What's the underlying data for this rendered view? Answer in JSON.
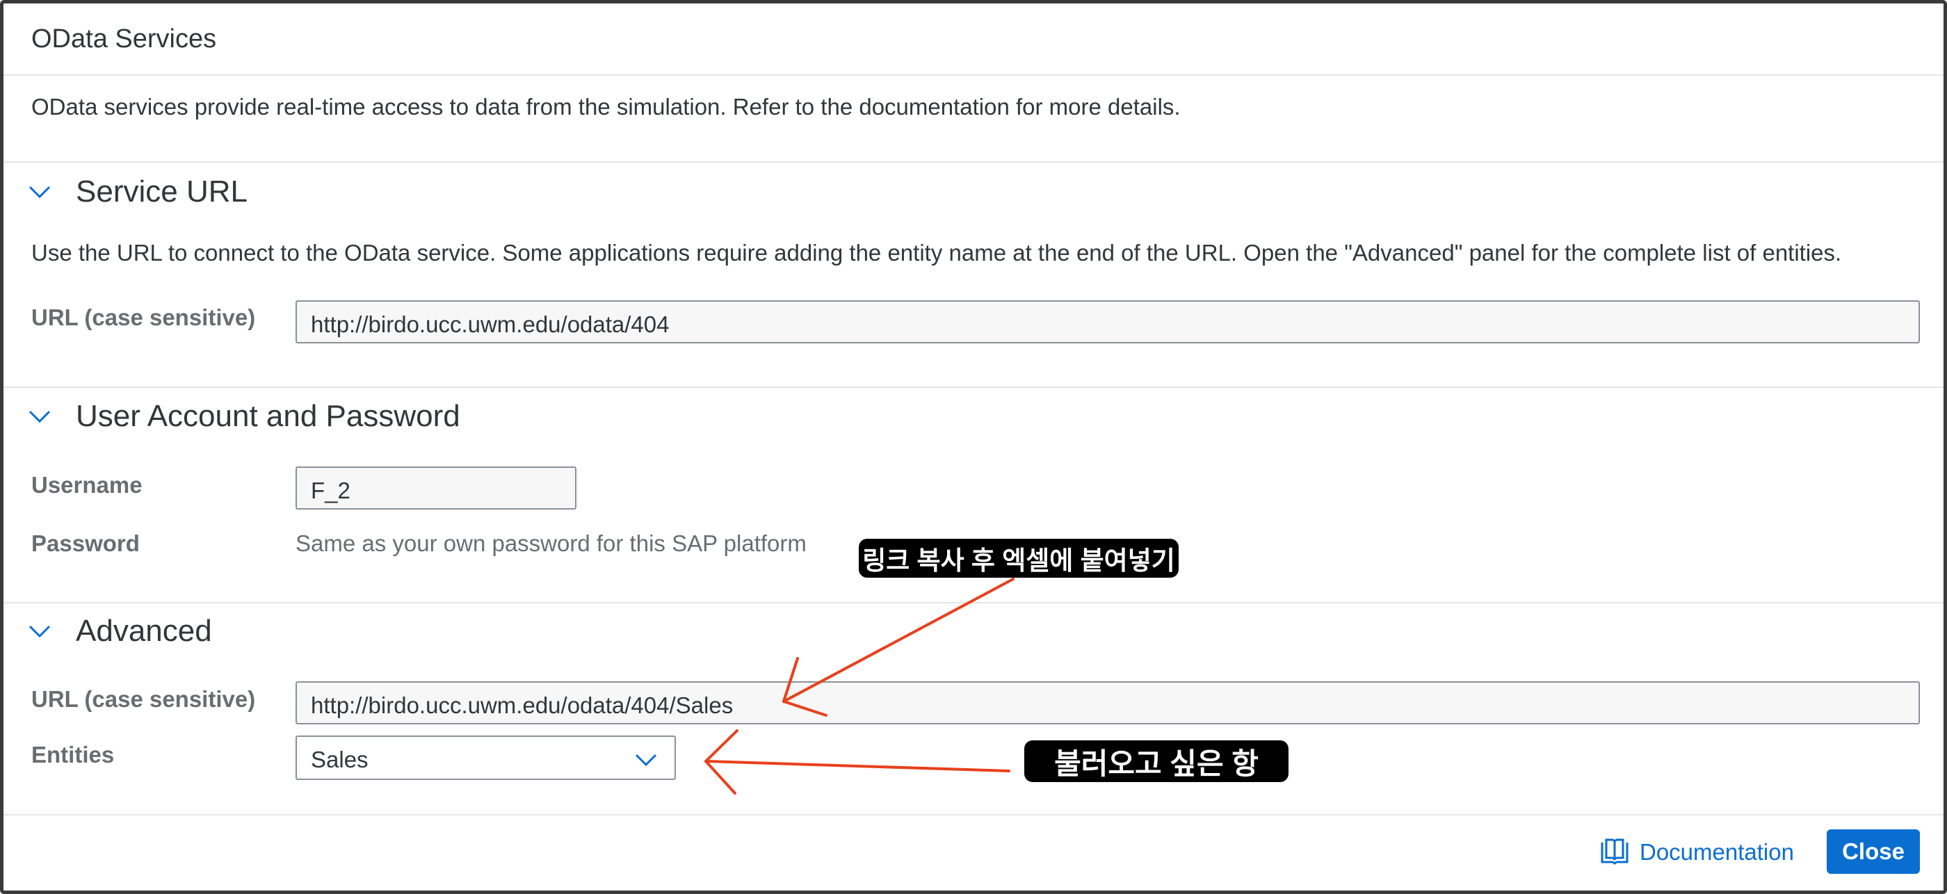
{
  "dialog": {
    "title": "OData Services",
    "intro": "OData services provide real-time access to data from the simulation. Refer to the documentation for more details."
  },
  "service_url": {
    "heading": "Service URL",
    "help": "Use the URL to connect to the OData service. Some applications require adding the entity name at the end of the URL. Open the \"Advanced\" panel for the complete list of entities.",
    "url_label": "URL (case sensitive)",
    "url_value": "http://birdo.ucc.uwm.edu/odata/404"
  },
  "account": {
    "heading": "User Account and Password",
    "username_label": "Username",
    "username_value": "F_2",
    "password_label": "Password",
    "password_text": "Same as your own password for this SAP platform"
  },
  "advanced": {
    "heading": "Advanced",
    "url_label": "URL (case sensitive)",
    "url_value": "http://birdo.ucc.uwm.edu/odata/404/Sales",
    "entities_label": "Entities",
    "entities_selected": "Sales"
  },
  "annotations": {
    "callout_1": "링크 복사 후 엑셀에 붙여넣기",
    "callout_2": "불러오고 싶은 항"
  },
  "footer": {
    "documentation_label": "Documentation",
    "close_label": "Close"
  },
  "colors": {
    "accent": "#0a6ed1",
    "annotation_arrow": "#e8401c"
  }
}
